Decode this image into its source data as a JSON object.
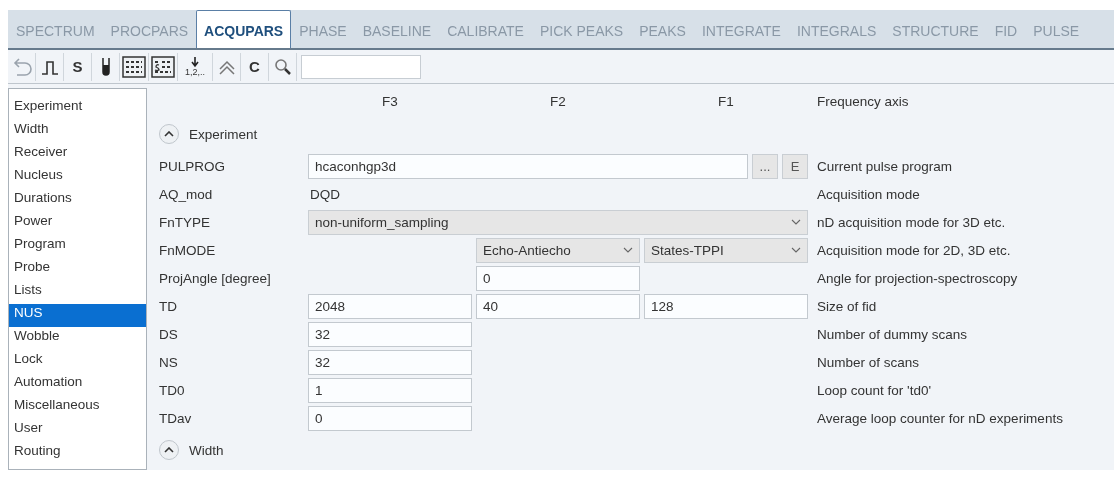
{
  "tabs": [
    {
      "label": "SPECTRUM",
      "selected": false
    },
    {
      "label": "PROCPARS",
      "selected": false
    },
    {
      "label": "ACQUPARS",
      "selected": true
    },
    {
      "label": "PHASE",
      "selected": false
    },
    {
      "label": "BASELINE",
      "selected": false
    },
    {
      "label": "CALIBRATE",
      "selected": false
    },
    {
      "label": "PICK PEAKS",
      "selected": false
    },
    {
      "label": "PEAKS",
      "selected": false
    },
    {
      "label": "INTEGRATE",
      "selected": false
    },
    {
      "label": "INTEGRALS",
      "selected": false
    },
    {
      "label": "STRUCTURE",
      "selected": false
    },
    {
      "label": "FID",
      "selected": false
    },
    {
      "label": "PULSE",
      "selected": false
    }
  ],
  "toolbar": [
    {
      "kind": "undo"
    },
    {
      "kind": "pulse"
    },
    {
      "kind": "text",
      "label": "S"
    },
    {
      "kind": "tube"
    },
    {
      "kind": "grid"
    },
    {
      "kind": "grid-s"
    },
    {
      "kind": "sort",
      "label": "1,2,.."
    },
    {
      "kind": "chevrons"
    },
    {
      "kind": "text",
      "label": "C"
    },
    {
      "kind": "search"
    }
  ],
  "sidebar": {
    "items": [
      {
        "label": "Experiment",
        "selected": false
      },
      {
        "label": "Width",
        "selected": false
      },
      {
        "label": "Receiver",
        "selected": false
      },
      {
        "label": "Nucleus",
        "selected": false
      },
      {
        "label": "Durations",
        "selected": false
      },
      {
        "label": "Power",
        "selected": false
      },
      {
        "label": "Program",
        "selected": false
      },
      {
        "label": "Probe",
        "selected": false
      },
      {
        "label": "Lists",
        "selected": false
      },
      {
        "label": "NUS",
        "selected": true
      },
      {
        "label": "Wobble",
        "selected": false
      },
      {
        "label": "Lock",
        "selected": false
      },
      {
        "label": "Automation",
        "selected": false
      },
      {
        "label": "Miscellaneous",
        "selected": false
      },
      {
        "label": "User",
        "selected": false
      },
      {
        "label": "Routing",
        "selected": false
      }
    ]
  },
  "header": {
    "columns": [
      "F3",
      "F2",
      "F1"
    ],
    "description": "Frequency axis"
  },
  "sections": [
    {
      "title": "Experiment",
      "expanded": true,
      "rows": [
        {
          "label": "PULPROG",
          "kind": "program",
          "value": "hcaconhgp3d",
          "buttons": [
            "...",
            "E"
          ],
          "description": "Current pulse program"
        },
        {
          "label": "AQ_mod",
          "kind": "cells",
          "cells": [
            {
              "kind": "text",
              "value": "DQD"
            },
            {
              "kind": "empty"
            },
            {
              "kind": "empty"
            }
          ],
          "description": "Acquisition mode"
        },
        {
          "label": "FnTYPE",
          "kind": "wide-select",
          "value": "non-uniform_sampling",
          "description": "nD acquisition mode for 3D etc."
        },
        {
          "label": "FnMODE",
          "kind": "cells",
          "cells": [
            {
              "kind": "empty"
            },
            {
              "kind": "select",
              "value": "Echo-Antiecho"
            },
            {
              "kind": "select",
              "value": "States-TPPI"
            }
          ],
          "description": "Acquisition mode for 2D, 3D etc."
        },
        {
          "label": "ProjAngle [degree]",
          "kind": "cells",
          "cells": [
            {
              "kind": "empty"
            },
            {
              "kind": "input",
              "value": "0"
            },
            {
              "kind": "empty"
            }
          ],
          "description": "Angle for projection-spectroscopy"
        },
        {
          "label": "TD",
          "kind": "cells",
          "cells": [
            {
              "kind": "input",
              "value": "2048"
            },
            {
              "kind": "input",
              "value": "40"
            },
            {
              "kind": "input",
              "value": "128"
            }
          ],
          "description": "Size of fid"
        },
        {
          "label": "DS",
          "kind": "cells",
          "cells": [
            {
              "kind": "input",
              "value": "32"
            },
            {
              "kind": "empty"
            },
            {
              "kind": "empty"
            }
          ],
          "description": "Number of dummy scans"
        },
        {
          "label": "NS",
          "kind": "cells",
          "cells": [
            {
              "kind": "input",
              "value": "32"
            },
            {
              "kind": "empty"
            },
            {
              "kind": "empty"
            }
          ],
          "description": "Number of scans"
        },
        {
          "label": "TD0",
          "kind": "cells",
          "cells": [
            {
              "kind": "input",
              "value": "1"
            },
            {
              "kind": "empty"
            },
            {
              "kind": "empty"
            }
          ],
          "description": "Loop count for 'td0'"
        },
        {
          "label": "TDav",
          "kind": "cells",
          "cells": [
            {
              "kind": "input",
              "value": "0"
            },
            {
              "kind": "empty"
            },
            {
              "kind": "empty"
            }
          ],
          "description": "Average loop counter for nD experiments"
        }
      ]
    },
    {
      "title": "Width",
      "expanded": true
    }
  ]
}
